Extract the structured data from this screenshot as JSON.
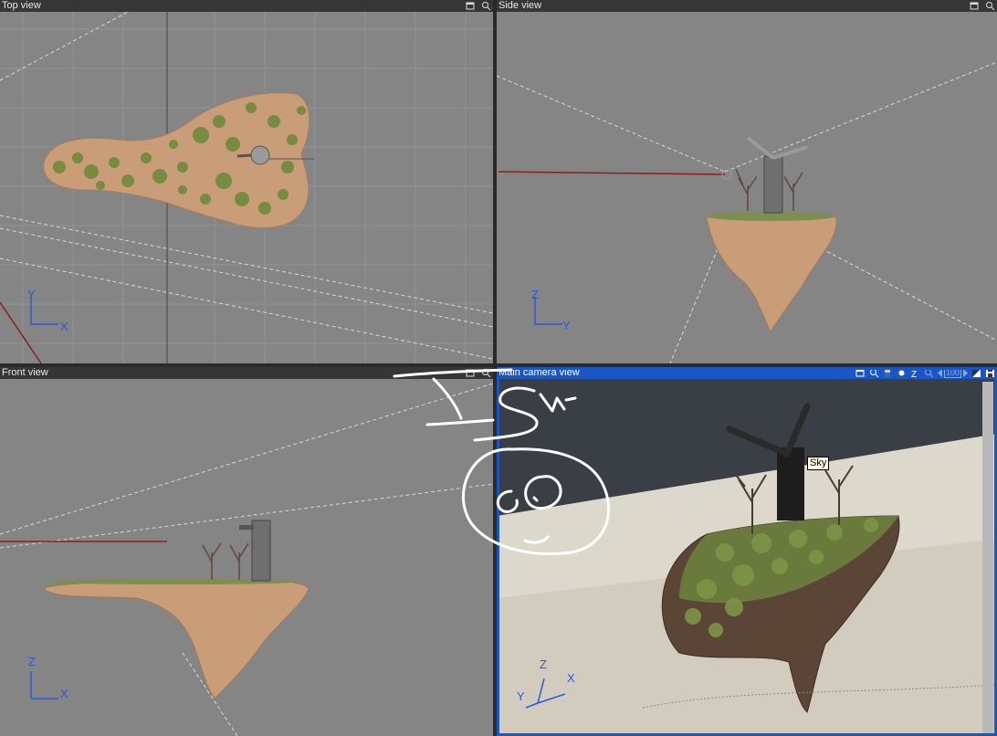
{
  "viewports": {
    "top": {
      "title": "Top view",
      "axis_v": "Y",
      "axis_h": "X"
    },
    "side": {
      "title": "Side view",
      "axis_v": "Z",
      "axis_h": "Y"
    },
    "front": {
      "title": "Front view",
      "axis_v": "Z",
      "axis_h": "X"
    },
    "camera": {
      "title": "Main camera view",
      "axis_z": "Z",
      "axis_x": "X",
      "axis_y": "Y",
      "tooltip": "Sky",
      "zoom_readout": "100"
    }
  },
  "colors": {
    "viewport_bg": "#858585",
    "titlebar_bg": "#363636",
    "active_titlebar_bg": "#1a57c4",
    "axis": "#2a5ad8",
    "terrain": "#c9a07c",
    "foliage": "#6f8a3c",
    "sky": "#3a3e45",
    "ground": "#ddd8cc"
  },
  "icons": [
    "maximize-icon",
    "camera-icon",
    "render-icon",
    "dot-icon",
    "z-icon",
    "lens-icon",
    "nav-arrows-icon",
    "toggle-icon",
    "save-icon"
  ]
}
